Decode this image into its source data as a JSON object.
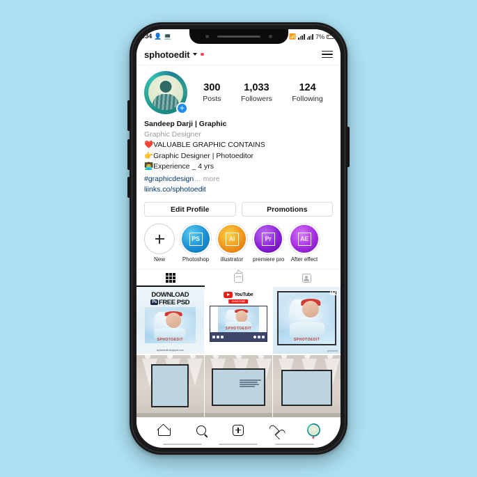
{
  "background_color": "#ace0f2",
  "status_bar": {
    "time": ":34",
    "left_icons": [
      "contact-icon",
      "monitor-icon"
    ],
    "right_icons": [
      "cast-icon",
      "wifi-icon",
      "signal-icon",
      "signal2-icon"
    ],
    "battery": "7%"
  },
  "header": {
    "username": "sphotoedit",
    "chevron": "chevron-down-icon",
    "status_dot": "new-story-dot",
    "menu": "hamburger-icon"
  },
  "profile": {
    "avatar_alt": "profile-photo",
    "add_story_badge": "+",
    "stats": [
      {
        "num": "300",
        "label": "Posts"
      },
      {
        "num": "1,033",
        "label": "Followers"
      },
      {
        "num": "124",
        "label": "Following"
      }
    ],
    "bio": {
      "name": "Sandeep Darji | Graphic",
      "category": "Graphic Designer",
      "line1": "❤️VALUABLE GRAPHIC CONTAINS",
      "line2": "👉Graphic Designer | Photoeditor",
      "line3": "👨‍💻Experience _ 4 yrs",
      "hashtag": "#graphicdesign",
      "more": "… more",
      "link": "liinks.co/sphotoedit"
    },
    "buttons": {
      "edit_profile": "Edit Profile",
      "promotions": "Promotions"
    }
  },
  "highlights": [
    {
      "label": "New",
      "icon": "plus-icon",
      "badge": ""
    },
    {
      "label": "Photoshop",
      "icon": "photoshop-icon",
      "badge": "PS"
    },
    {
      "label": "illustrator",
      "icon": "illustrator-icon",
      "badge": "AI"
    },
    {
      "label": "premiere pro",
      "icon": "premiere-icon",
      "badge": "Pr"
    },
    {
      "label": "After effect",
      "icon": "aftereffects-icon",
      "badge": "AE"
    }
  ],
  "tabs": [
    {
      "name": "grid-tab",
      "icon": "grid-icon",
      "active": true
    },
    {
      "name": "igtv-tab",
      "icon": "igtv-icon",
      "active": false
    },
    {
      "name": "tagged-tab",
      "icon": "tagged-icon",
      "active": false
    }
  ],
  "posts": {
    "post1": {
      "title_line1": "DOWNLOAD",
      "badge": "▤",
      "title_line2": "FREE PSD",
      "watermark": "SPHOTOEDIT",
      "caption": "sphotoedit.blogspot.com"
    },
    "post2": {
      "brand": "YouTube",
      "subscribe": "SUBSCRIBE",
      "watermark": "SPHOTOEDIT",
      "icon": "reel-icon"
    },
    "post3": {
      "watermark": "SPHOTOEDIT",
      "caption": "sphotoedit",
      "icon": "carousel-icon"
    },
    "post4": {
      "alt": "gallery-wall-fox-frame"
    },
    "post5": {
      "alt": "gallery-wall-giraffe-frame"
    },
    "post6": {
      "alt": "gallery-wall-landscape-frame"
    }
  },
  "bottom_nav": [
    {
      "name": "home-icon",
      "label": "Home"
    },
    {
      "name": "search-icon",
      "label": "Search"
    },
    {
      "name": "add-icon",
      "label": "Add"
    },
    {
      "name": "heart-icon",
      "label": "Activity"
    },
    {
      "name": "profile-avatar-icon",
      "label": "Profile"
    }
  ]
}
